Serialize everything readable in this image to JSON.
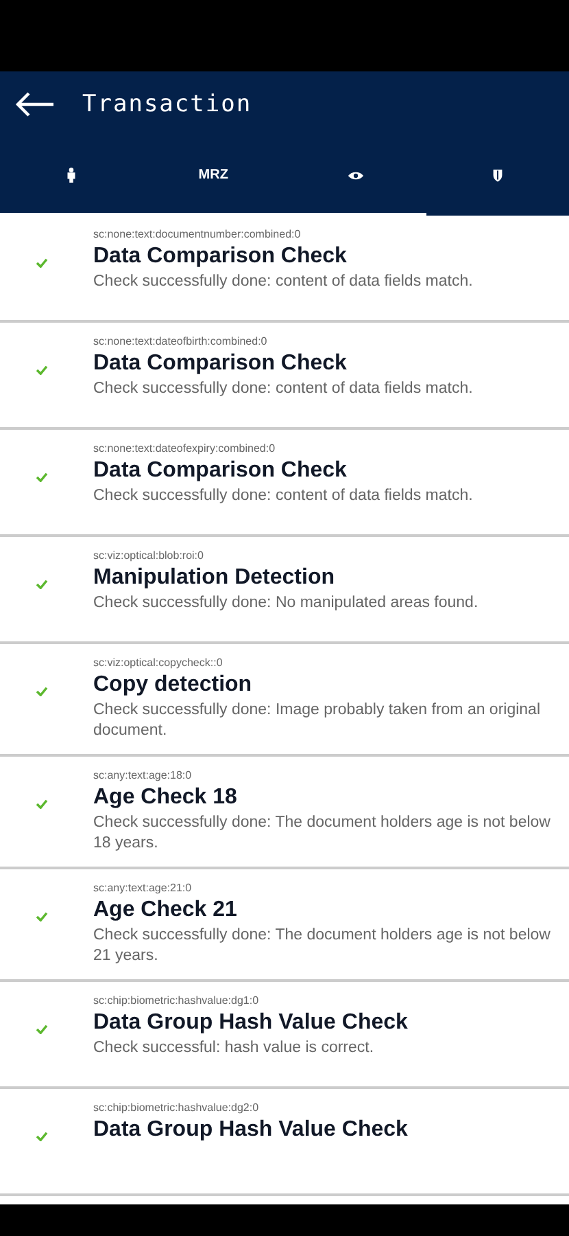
{
  "app_bar": {
    "title": "Transaction"
  },
  "tabs": [
    {
      "kind": "person",
      "selected": false
    },
    {
      "kind": "text",
      "label": "MRZ",
      "selected": false
    },
    {
      "kind": "eye",
      "selected": false
    },
    {
      "kind": "shield",
      "selected": true
    }
  ],
  "checks": [
    {
      "code": "sc:none:text:documentnumber:combined:0",
      "title": "Data Comparison Check",
      "description": "Check successfully done: content of data fields match.",
      "passed": true
    },
    {
      "code": "sc:none:text:dateofbirth:combined:0",
      "title": "Data Comparison Check",
      "description": "Check successfully done: content of data fields match.",
      "passed": true
    },
    {
      "code": "sc:none:text:dateofexpiry:combined:0",
      "title": "Data Comparison Check",
      "description": "Check successfully done: content of data fields match.",
      "passed": true
    },
    {
      "code": "sc:viz:optical:blob:roi:0",
      "title": "Manipulation Detection",
      "description": "Check successfully done: No manipulated areas found.",
      "passed": true
    },
    {
      "code": "sc:viz:optical:copycheck::0",
      "title": "Copy detection",
      "description": "Check successfully done: Image probably taken from an original document.",
      "passed": true
    },
    {
      "code": "sc:any:text:age:18:0",
      "title": "Age Check 18",
      "description": "Check successfully done: The document holders age is not below 18 years.",
      "passed": true
    },
    {
      "code": "sc:any:text:age:21:0",
      "title": "Age Check 21",
      "description": "Check successfully done: The document holders age is not below 21 years.",
      "passed": true
    },
    {
      "code": "sc:chip:biometric:hashvalue:dg1:0",
      "title": "Data Group Hash Value Check",
      "description": "Check successful: hash value is correct.",
      "passed": true
    },
    {
      "code": "sc:chip:biometric:hashvalue:dg2:0",
      "title": "Data Group Hash Value Check",
      "passed": true
    }
  ]
}
